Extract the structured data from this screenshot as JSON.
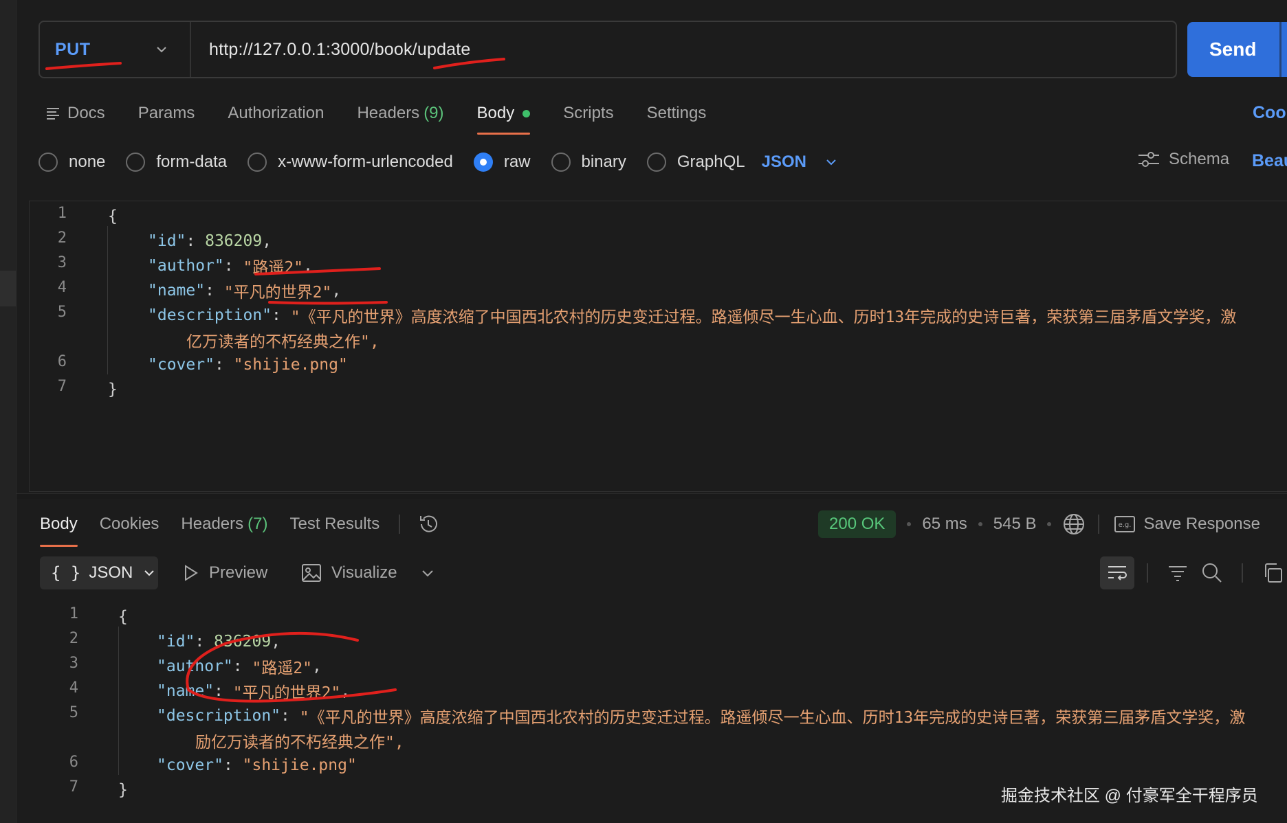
{
  "request": {
    "method": "PUT",
    "url": "http://127.0.0.1:3000/book/update",
    "send_label": "Send"
  },
  "request_tabs": [
    {
      "label": "Docs"
    },
    {
      "label": "Params"
    },
    {
      "label": "Authorization"
    },
    {
      "label": "Headers",
      "count": "(9)"
    },
    {
      "label": "Body"
    },
    {
      "label": "Scripts"
    },
    {
      "label": "Settings"
    }
  ],
  "cookies_link": "Coo",
  "body_types": {
    "none": "none",
    "form_data": "form-data",
    "urlencoded": "x-www-form-urlencoded",
    "raw": "raw",
    "binary": "binary",
    "graphql": "GraphQL",
    "format": "JSON",
    "schema": "Schema",
    "beautify": "Beau"
  },
  "request_body": [
    {
      "n": "1",
      "text": "{"
    },
    {
      "n": "2",
      "key": "\"id\"",
      "value": "836209",
      "comma": ","
    },
    {
      "n": "3",
      "key": "\"author\"",
      "value": "\"路遥2\"",
      "comma": ","
    },
    {
      "n": "4",
      "key": "\"name\"",
      "value": "\"平凡的世界2\"",
      "comma": ","
    },
    {
      "n": "5",
      "key": "\"description\"",
      "value": "\"《平凡的世界》高度浓缩了中国西北农村的历史变迁过程。路遥倾尽一生心血、历时13年完成的史诗巨著，荣获第三届茅盾文学奖，激",
      "cont": "亿万读者的不朽经典之作\","
    },
    {
      "n": "6",
      "key": "\"cover\"",
      "value": "\"shijie.png\""
    },
    {
      "n": "7",
      "text": "}"
    }
  ],
  "response_tabs": [
    {
      "label": "Body"
    },
    {
      "label": "Cookies"
    },
    {
      "label": "Headers",
      "count": "(7)"
    },
    {
      "label": "Test Results"
    }
  ],
  "response_status": {
    "status": "200 OK",
    "time": "65 ms",
    "size": "545 B",
    "save_label": "Save Response"
  },
  "response_toolbar": {
    "format": "JSON",
    "braces": "{ }",
    "preview": "Preview",
    "visualize": "Visualize"
  },
  "response_body": [
    {
      "n": "1",
      "text": "{"
    },
    {
      "n": "2",
      "key": "\"id\"",
      "value": "836209",
      "comma": ","
    },
    {
      "n": "3",
      "key": "\"author\"",
      "value": "\"路遥2\"",
      "comma": ","
    },
    {
      "n": "4",
      "key": "\"name\"",
      "value": "\"平凡的世界2\"",
      "comma": ","
    },
    {
      "n": "5",
      "key": "\"description\"",
      "value": "\"《平凡的世界》高度浓缩了中国西北农村的历史变迁过程。路遥倾尽一生心血、历时13年完成的史诗巨著，荣获第三届茅盾文学奖，激",
      "cont": "励亿万读者的不朽经典之作\","
    },
    {
      "n": "6",
      "key": "\"cover\"",
      "value": "\"shijie.png\""
    },
    {
      "n": "7",
      "text": "}"
    }
  ],
  "watermark": "掘金技术社区 @ 付豪军全干程序员",
  "colors": {
    "accent_blue": "#2f6fdb",
    "method_blue": "#5b9bf8",
    "tab_underline": "#e8704a",
    "status_green": "#58c77b",
    "annotation_red": "#e0201c"
  }
}
